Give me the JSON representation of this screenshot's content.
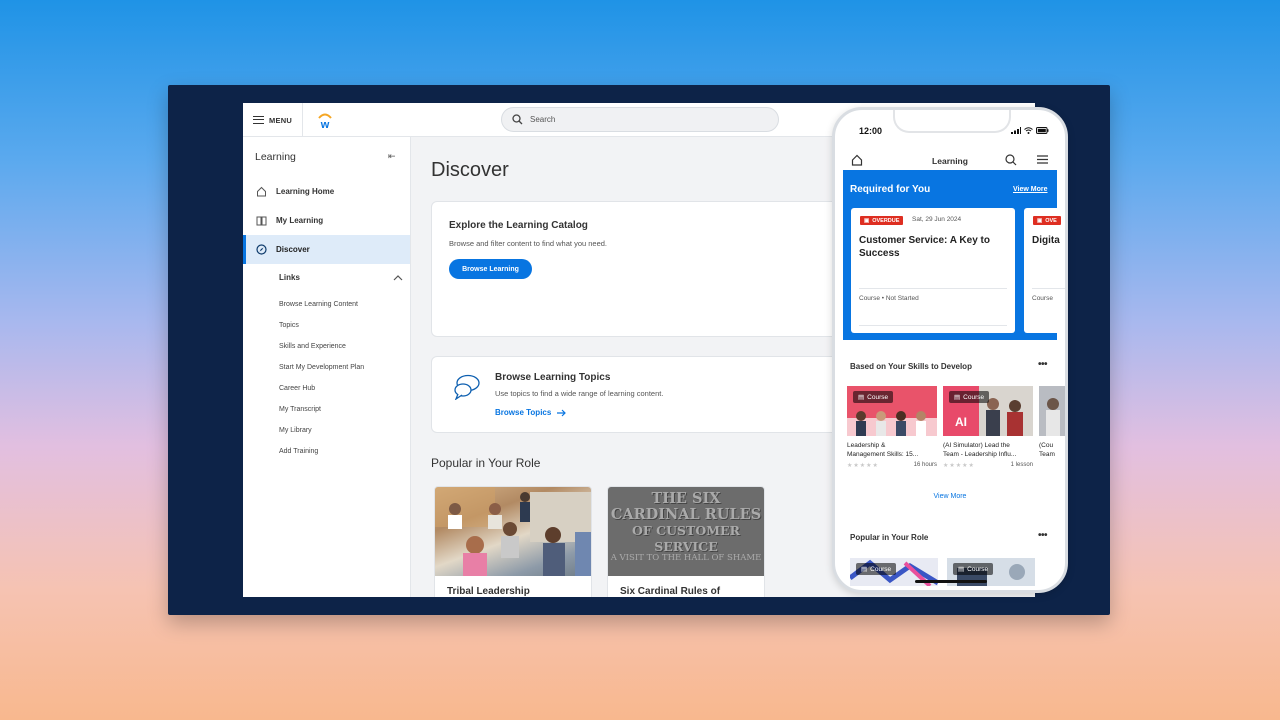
{
  "topbar": {
    "menu_label": "MENU",
    "search_placeholder": "Search"
  },
  "sidebar": {
    "title": "Learning",
    "items": [
      {
        "label": "Learning Home",
        "icon": "home-icon"
      },
      {
        "label": "My Learning",
        "icon": "book-icon"
      },
      {
        "label": "Discover",
        "icon": "compass-icon",
        "active": true
      }
    ],
    "links_heading": "Links",
    "links": [
      "Browse Learning Content",
      "Topics",
      "Skills and Experience",
      "Start My Development Plan",
      "Career Hub",
      "My Transcript",
      "My Library",
      "Add Training"
    ]
  },
  "main": {
    "title": "Discover",
    "catalog_card": {
      "title": "Explore the Learning Catalog",
      "description": "Browse and filter content to find what you need.",
      "button": "Browse Learning"
    },
    "topics_card": {
      "title": "Browse Learning Topics",
      "description": "Use topics to find a wide range of learning content.",
      "link": "Browse Topics"
    },
    "popular_heading": "Popular in Your Role",
    "popular": [
      {
        "title": "Tribal Leadership"
      },
      {
        "title": "Six Cardinal Rules of",
        "image_text": [
          "THE SIX",
          "CARDINAL RULES",
          "OF CUSTOMER SERVICE"
        ],
        "image_subtext": "A VISIT TO THE HALL OF SHAME"
      }
    ]
  },
  "phone": {
    "time": "12:00",
    "nav_title": "Learning",
    "required": {
      "title": "Required for You",
      "view_more": "View More",
      "cards": [
        {
          "badge": "OVERDUE",
          "date": "Sat, 29 Jun 2024",
          "title": "Customer Service: A Key to Success",
          "meta": "Course • Not Started"
        },
        {
          "badge": "OVE",
          "date": "",
          "title": "Digita",
          "meta": "Course"
        }
      ]
    },
    "skills": {
      "title": "Based on Your Skills to Develop",
      "items": [
        {
          "chip": "Course",
          "title": "Leadership &\nManagement Skills: 15...",
          "duration": "16 hours"
        },
        {
          "chip": "Course",
          "title": "(AI Simulator) Lead the\nTeam - Leadership Influ...",
          "duration": "1 lesson"
        },
        {
          "chip": "",
          "title": "(Cou\nTeam",
          "duration": ""
        }
      ],
      "view_more": "View More"
    },
    "popular": {
      "title": "Popular in Your Role",
      "chips": [
        "Course",
        "Course"
      ]
    }
  },
  "colors": {
    "accent": "#0875e1",
    "frame": "#0d2348",
    "overdue": "#de2e21"
  }
}
